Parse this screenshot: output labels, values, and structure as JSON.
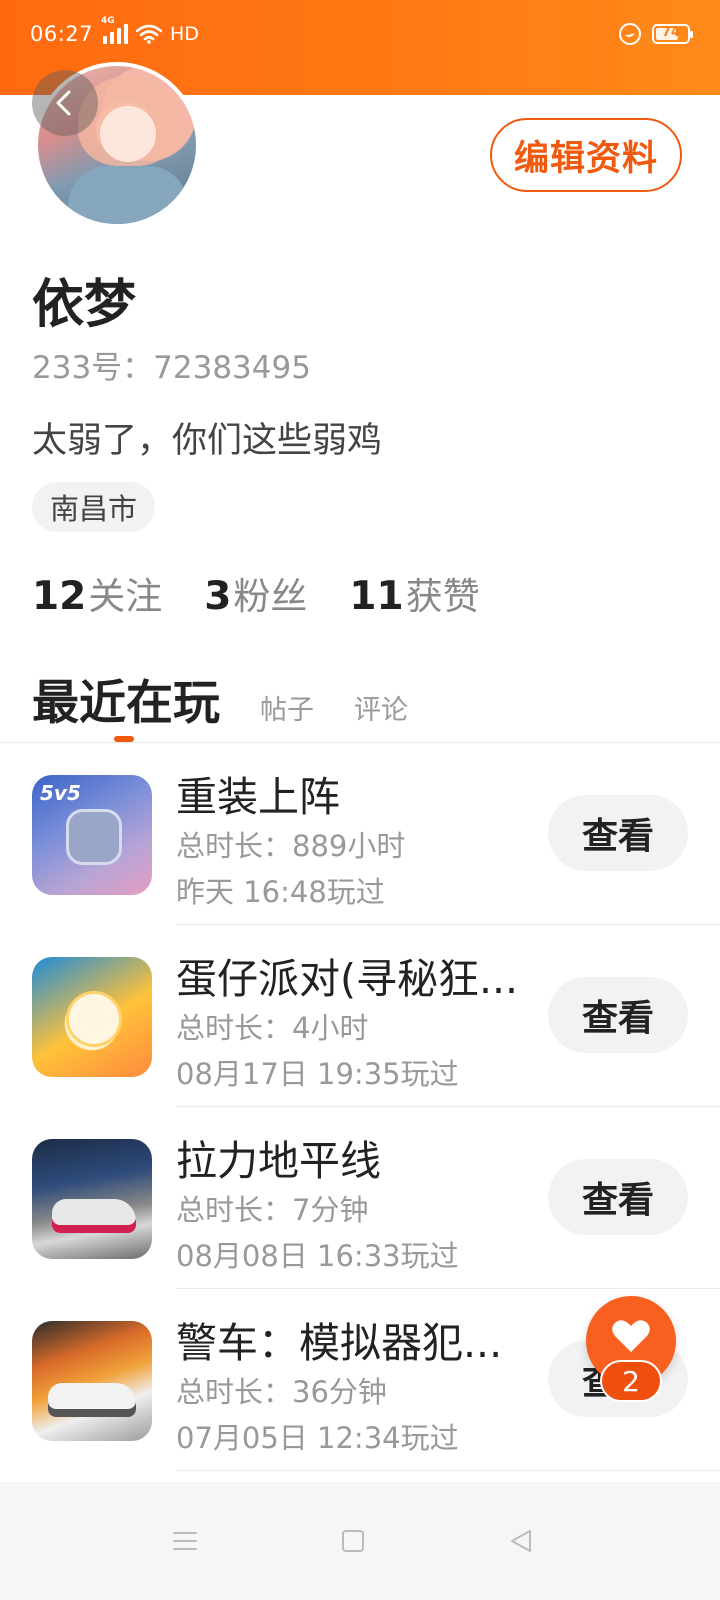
{
  "status_bar": {
    "time": "06:27",
    "network": "4G",
    "hd": "HD",
    "battery": "74",
    "battery_level": 0.74
  },
  "profile": {
    "name": "依梦",
    "id_line": "233号：72383495",
    "bio": "太弱了，你们这些弱鸡",
    "location": "南昌市",
    "edit_label": "编辑资料"
  },
  "stats": [
    {
      "num": "12",
      "label": "关注"
    },
    {
      "num": "3",
      "label": "粉丝"
    },
    {
      "num": "11",
      "label": "获赞"
    }
  ],
  "tabs": {
    "active": "最近在玩",
    "posts": "帖子",
    "comments": "评论"
  },
  "games": [
    {
      "title": "重装上阵",
      "duration": "总时长：889小时",
      "last_played": "昨天 16:48玩过",
      "button": "查看",
      "icon_label": "5v5"
    },
    {
      "title": "蛋仔派对(寻秘狂...",
      "duration": "总时长：4小时",
      "last_played": "08月17日 19:35玩过",
      "button": "查看"
    },
    {
      "title": "拉力地平线",
      "duration": "总时长：7分钟",
      "last_played": "08月08日 16:33玩过",
      "button": "查看"
    },
    {
      "title": "警车：模拟器犯...",
      "duration": "总时长：36分钟",
      "last_played": "07月05日 12:34玩过",
      "button": "查看"
    }
  ],
  "float_like": {
    "count": "2"
  },
  "colors": {
    "accent": "#f05a0e",
    "header": "#ff7a14"
  }
}
